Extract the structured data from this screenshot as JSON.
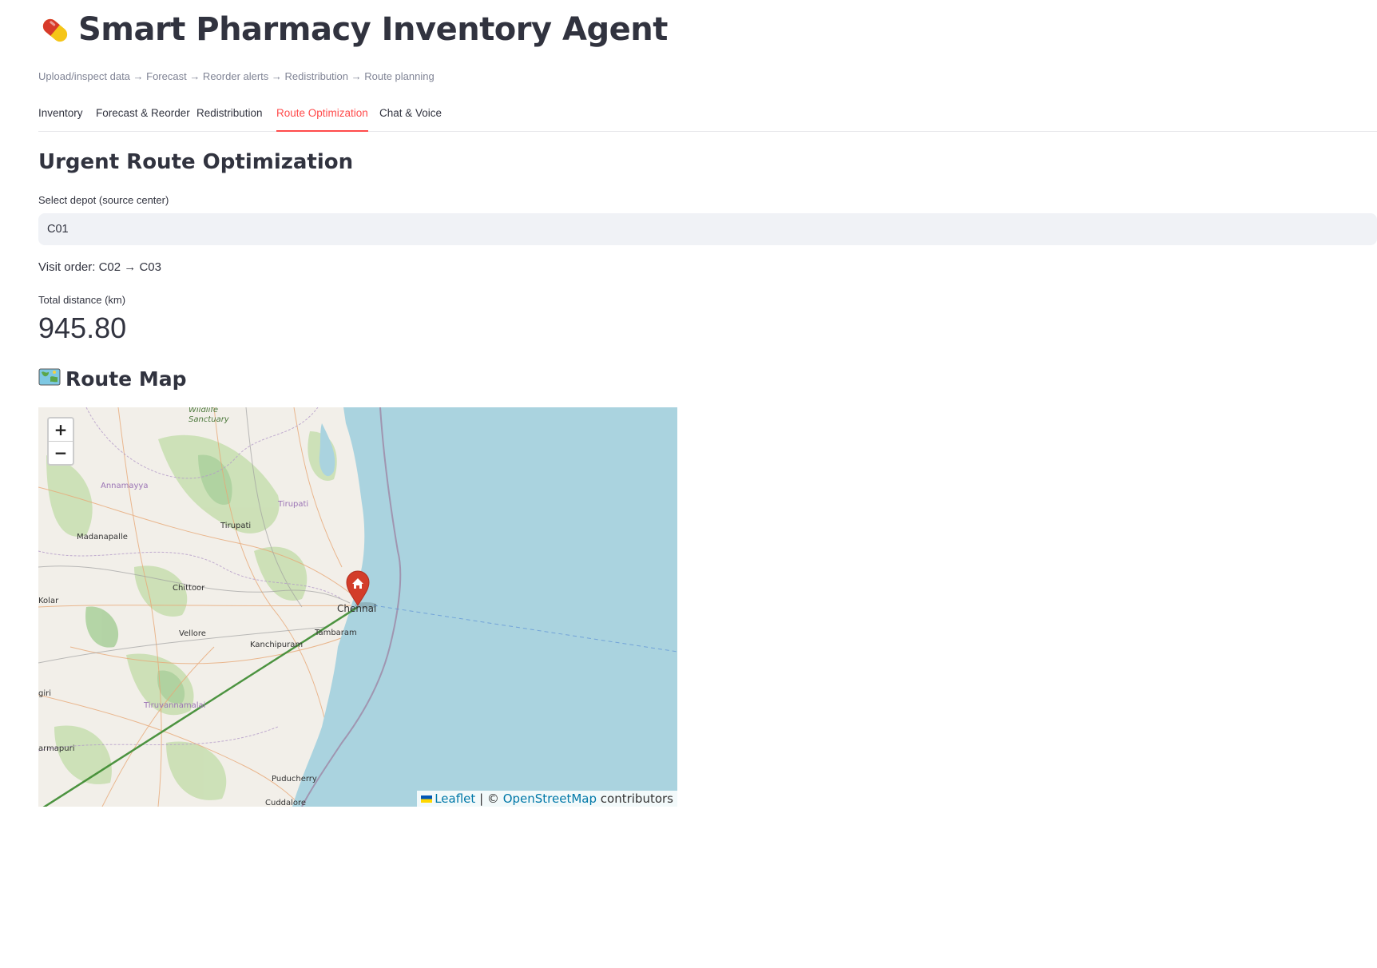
{
  "header": {
    "title": "Smart Pharmacy Inventory Agent",
    "caption": "Upload/inspect data → Forecast → Reorder alerts → Redistribution → Route planning",
    "icon": "pill-icon"
  },
  "tabs": [
    {
      "label": "Inventory",
      "active": false
    },
    {
      "label": "Forecast & Reorder",
      "active": false
    },
    {
      "label": "Redistribution",
      "active": false
    },
    {
      "label": "Route Optimization",
      "active": true
    },
    {
      "label": "Chat & Voice",
      "active": false
    }
  ],
  "section": {
    "heading": "Urgent Route Optimization",
    "depot_label": "Select depot (source center)",
    "depot_value": "C01",
    "visit_order": "Visit order: C02 → C03",
    "distance_label": "Total distance (km)",
    "distance_value": "945.80"
  },
  "map_section": {
    "heading": "Route Map",
    "icon": "world-map-icon",
    "place_labels": {
      "wildlife": "Wildlife",
      "sanctuary": "Sanctuary",
      "annamayya": "Annamayya",
      "tirupati_district": "Tirupati",
      "tirupati": "Tirupati",
      "madanapalle": "Madanapalle",
      "chittoor": "Chittoor",
      "kolar": "Kolar",
      "vellore": "Vellore",
      "chennai": "Chennai",
      "tambaram": "Tambaram",
      "kanchipuram": "Kanchipuram",
      "tiruvannamalai": "Tiruvannamalai",
      "giri": "giri",
      "dharmapuri": "armapuri",
      "puducherry": "Puducherry",
      "cuddalore": "Cuddalore"
    },
    "zoom_in": "+",
    "zoom_out": "−",
    "attribution": {
      "leaflet": "Leaflet",
      "separator": "| ©",
      "osm": "OpenStreetMap",
      "contributors": "contributors"
    },
    "colors": {
      "sea": "#aad3df",
      "land": "#f2efe9",
      "route": "#3b8a2e",
      "marker": "#d33d2a"
    }
  }
}
